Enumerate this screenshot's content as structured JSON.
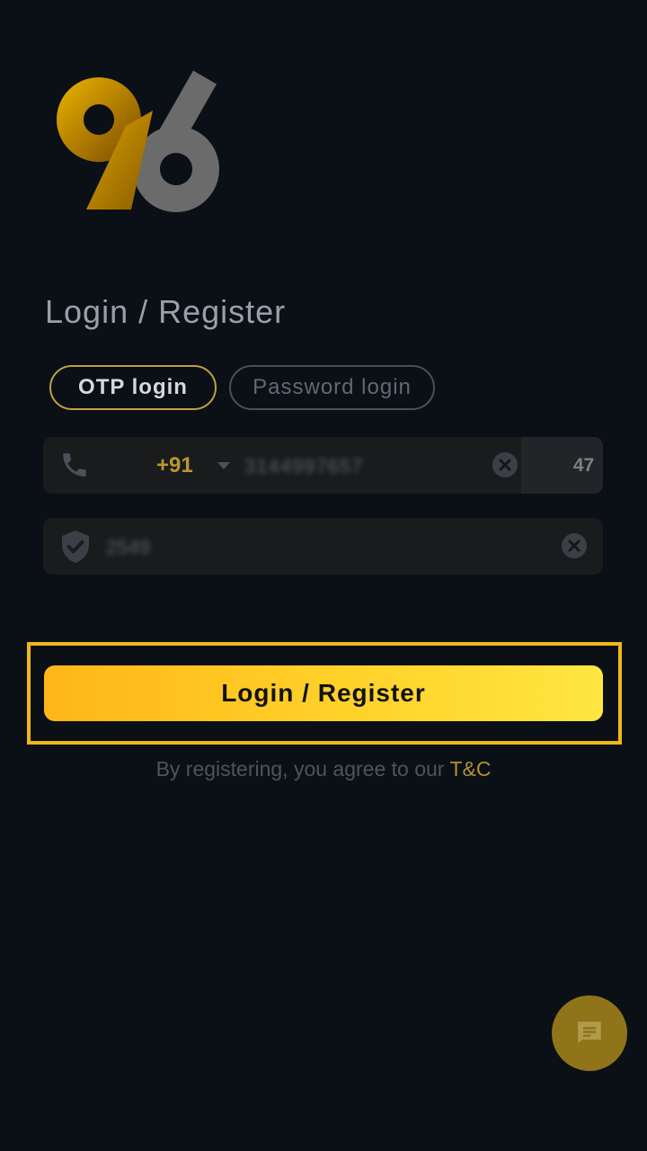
{
  "brand": {
    "logo_text": "96"
  },
  "header": {
    "title": "Login / Register"
  },
  "tabs": [
    {
      "label": "OTP login",
      "active": true
    },
    {
      "label": "Password login",
      "active": false
    }
  ],
  "phone": {
    "icon": "phone-icon",
    "country_code": "+91",
    "value": "3144997657",
    "countdown": "47"
  },
  "otp": {
    "icon": "shield-check-icon",
    "value": "2549"
  },
  "submit": {
    "label": "Login / Register"
  },
  "terms": {
    "text": "By registering, you agree to our ",
    "link": "T&C"
  },
  "chat": {
    "icon": "chat-icon"
  },
  "colors": {
    "background": "#0b0f16",
    "accent": "#f0b815",
    "button_start": "#ffb618",
    "button_end": "#ffe640",
    "link": "#b1912c"
  }
}
